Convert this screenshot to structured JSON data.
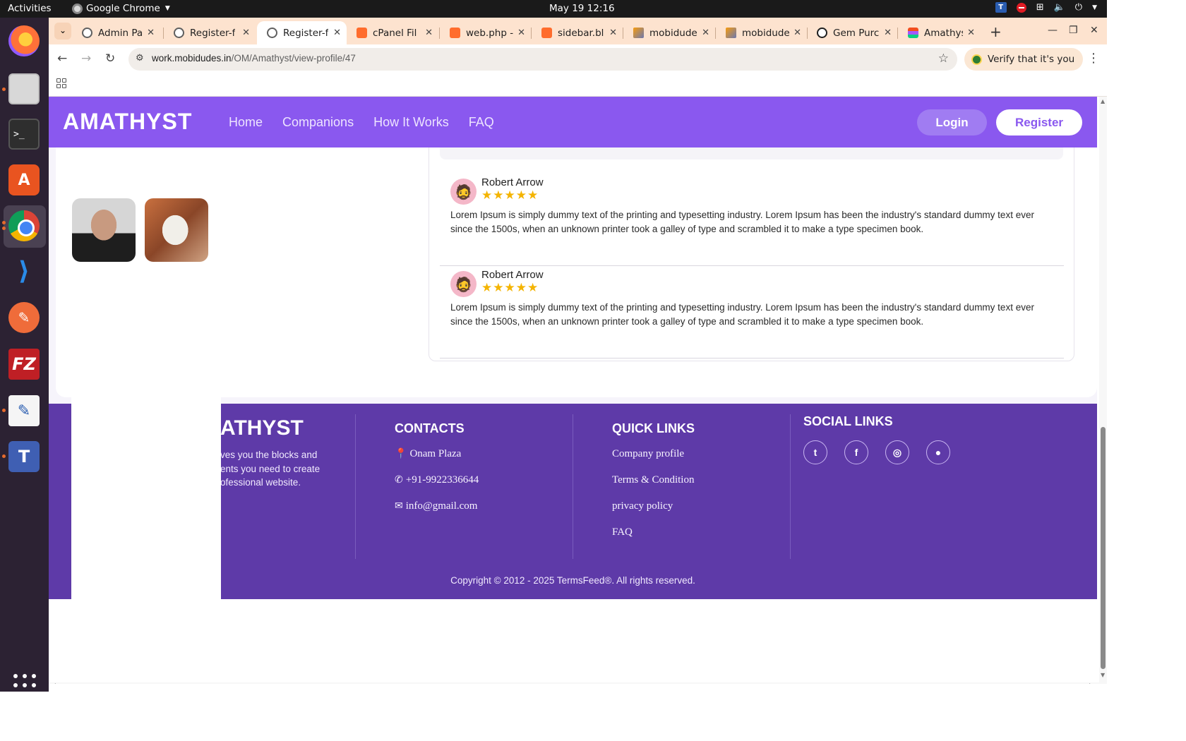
{
  "system": {
    "activities": "Activities",
    "app_name": "Google Chrome",
    "clock": "May 19  12:16"
  },
  "tabs": [
    {
      "title": "Admin Pa",
      "icon": "globe-icon"
    },
    {
      "title": "Register-f",
      "icon": "globe-icon"
    },
    {
      "title": "Register-f",
      "icon": "globe-icon",
      "active": true
    },
    {
      "title": "cPanel Fil",
      "icon": "cpanel-icon"
    },
    {
      "title": "web.php -",
      "icon": "cpanel-icon"
    },
    {
      "title": "sidebar.bl",
      "icon": "cpanel-icon"
    },
    {
      "title": "mobidude",
      "icon": "phpmyadmin-icon"
    },
    {
      "title": "mobidude",
      "icon": "phpmyadmin-icon"
    },
    {
      "title": "Gem Purc",
      "icon": "openai-icon"
    },
    {
      "title": "Amathyst",
      "icon": "figma-icon"
    }
  ],
  "browser": {
    "url_host": "work.mobidudes.in",
    "url_path": "/OM/Amathyst/view-profile/47",
    "verify_label": "Verify that it's you"
  },
  "site": {
    "logo": "AMATHYST",
    "nav": [
      "Home",
      "Companions",
      "How It Works",
      "FAQ"
    ],
    "login": "Login",
    "register": "Register",
    "brand_color": "#8a58ef"
  },
  "reviews": [
    {
      "name": "Robert Arrow",
      "rating": 5,
      "stars": "★★★★★",
      "text": "Lorem Ipsum is simply dummy text of the printing and typesetting industry. Lorem Ipsum has been the industry's standard dummy text ever since the 1500s, when an unknown printer took a galley of type and scrambled it to make a type specimen book."
    },
    {
      "name": "Robert Arrow",
      "rating": 5,
      "stars": "★★★★★",
      "text": "Lorem Ipsum is simply dummy text of the printing and typesetting industry. Lorem Ipsum has been the industry's standard dummy text ever since the 1500s, when an unknown printer took a galley of type and scrambled it to make a type specimen book."
    }
  ],
  "footer": {
    "logo_visible": "ATHYST",
    "about_lines": [
      "ves you the blocks and",
      "ents you need to create",
      "ofessional website."
    ],
    "contacts_title": "CONTACTS",
    "address": "Onam Plaza",
    "phone": "+91-9922336644",
    "email": "info@gmail.com",
    "quick_links_title": "QUICK LINKS",
    "quick_links": [
      "Company profile",
      "Terms & Condition",
      "privacy policy",
      "FAQ"
    ],
    "social_title": "SOCIAL LINKS",
    "social": [
      "twitter-icon",
      "facebook-icon",
      "instagram-icon",
      "github-icon"
    ],
    "copyright": "Copyright © 2012 - 2025 TermsFeed®. All rights reserved.",
    "footer_color": "#5e3aa8"
  }
}
